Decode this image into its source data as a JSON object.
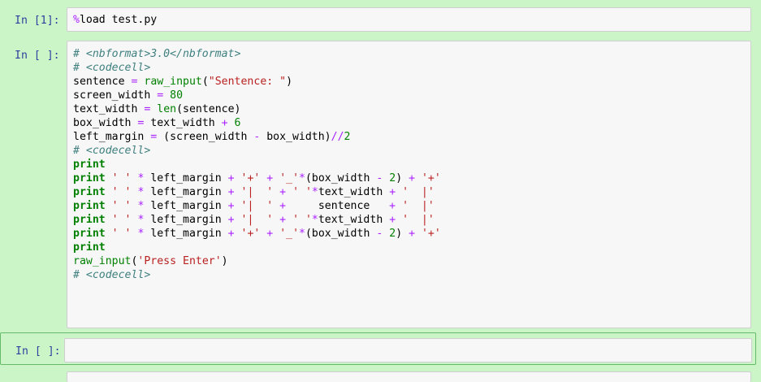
{
  "cells": [
    {
      "prompt": "In [1]:",
      "lines": [
        [
          {
            "t": "magic",
            "v": "%"
          },
          {
            "t": "plain",
            "v": "load test.py"
          }
        ]
      ]
    },
    {
      "prompt": "In [ ]:",
      "lines": [
        [
          {
            "t": "comment",
            "v": "# <nbformat>3.0</nbformat>"
          }
        ],
        [
          {
            "t": "comment",
            "v": "# <codecell>"
          }
        ],
        [
          {
            "t": "plain",
            "v": "sentence "
          },
          {
            "t": "op",
            "v": "="
          },
          {
            "t": "plain",
            "v": " "
          },
          {
            "t": "builtin",
            "v": "raw_input"
          },
          {
            "t": "plain",
            "v": "("
          },
          {
            "t": "string",
            "v": "\"Sentence: \""
          },
          {
            "t": "plain",
            "v": ")"
          }
        ],
        [
          {
            "t": "plain",
            "v": "screen_width "
          },
          {
            "t": "op",
            "v": "="
          },
          {
            "t": "plain",
            "v": " "
          },
          {
            "t": "number",
            "v": "80"
          }
        ],
        [
          {
            "t": "plain",
            "v": "text_width "
          },
          {
            "t": "op",
            "v": "="
          },
          {
            "t": "plain",
            "v": " "
          },
          {
            "t": "builtin",
            "v": "len"
          },
          {
            "t": "plain",
            "v": "(sentence)"
          }
        ],
        [
          {
            "t": "plain",
            "v": "box_width "
          },
          {
            "t": "op",
            "v": "="
          },
          {
            "t": "plain",
            "v": " text_width "
          },
          {
            "t": "op",
            "v": "+"
          },
          {
            "t": "plain",
            "v": " "
          },
          {
            "t": "number",
            "v": "6"
          }
        ],
        [
          {
            "t": "plain",
            "v": "left_margin "
          },
          {
            "t": "op",
            "v": "="
          },
          {
            "t": "plain",
            "v": " (screen_width "
          },
          {
            "t": "op",
            "v": "-"
          },
          {
            "t": "plain",
            "v": " box_width)"
          },
          {
            "t": "op",
            "v": "//"
          },
          {
            "t": "number",
            "v": "2"
          }
        ],
        [
          {
            "t": "comment",
            "v": "# <codecell>"
          }
        ],
        [
          {
            "t": "keyword",
            "v": "print"
          }
        ],
        [
          {
            "t": "keyword",
            "v": "print"
          },
          {
            "t": "plain",
            "v": " "
          },
          {
            "t": "string",
            "v": "' '"
          },
          {
            "t": "plain",
            "v": " "
          },
          {
            "t": "op",
            "v": "*"
          },
          {
            "t": "plain",
            "v": " left_margin "
          },
          {
            "t": "op",
            "v": "+"
          },
          {
            "t": "plain",
            "v": " "
          },
          {
            "t": "string",
            "v": "'+'"
          },
          {
            "t": "plain",
            "v": " "
          },
          {
            "t": "op",
            "v": "+"
          },
          {
            "t": "plain",
            "v": " "
          },
          {
            "t": "string",
            "v": "'_'"
          },
          {
            "t": "op",
            "v": "*"
          },
          {
            "t": "plain",
            "v": "(box_width "
          },
          {
            "t": "op",
            "v": "-"
          },
          {
            "t": "plain",
            "v": " "
          },
          {
            "t": "number",
            "v": "2"
          },
          {
            "t": "plain",
            "v": ") "
          },
          {
            "t": "op",
            "v": "+"
          },
          {
            "t": "plain",
            "v": " "
          },
          {
            "t": "string",
            "v": "'+'"
          }
        ],
        [
          {
            "t": "keyword",
            "v": "print"
          },
          {
            "t": "plain",
            "v": " "
          },
          {
            "t": "string",
            "v": "' '"
          },
          {
            "t": "plain",
            "v": " "
          },
          {
            "t": "op",
            "v": "*"
          },
          {
            "t": "plain",
            "v": " left_margin "
          },
          {
            "t": "op",
            "v": "+"
          },
          {
            "t": "plain",
            "v": " "
          },
          {
            "t": "string",
            "v": "'|  '"
          },
          {
            "t": "plain",
            "v": " "
          },
          {
            "t": "op",
            "v": "+"
          },
          {
            "t": "plain",
            "v": " "
          },
          {
            "t": "string",
            "v": "' '"
          },
          {
            "t": "op",
            "v": "*"
          },
          {
            "t": "plain",
            "v": "text_width "
          },
          {
            "t": "op",
            "v": "+"
          },
          {
            "t": "plain",
            "v": " "
          },
          {
            "t": "string",
            "v": "'  |'"
          }
        ],
        [
          {
            "t": "keyword",
            "v": "print"
          },
          {
            "t": "plain",
            "v": " "
          },
          {
            "t": "string",
            "v": "' '"
          },
          {
            "t": "plain",
            "v": " "
          },
          {
            "t": "op",
            "v": "*"
          },
          {
            "t": "plain",
            "v": " left_margin "
          },
          {
            "t": "op",
            "v": "+"
          },
          {
            "t": "plain",
            "v": " "
          },
          {
            "t": "string",
            "v": "'|  '"
          },
          {
            "t": "plain",
            "v": " "
          },
          {
            "t": "op",
            "v": "+"
          },
          {
            "t": "plain",
            "v": "     sentence   "
          },
          {
            "t": "op",
            "v": "+"
          },
          {
            "t": "plain",
            "v": " "
          },
          {
            "t": "string",
            "v": "'  |'"
          }
        ],
        [
          {
            "t": "keyword",
            "v": "print"
          },
          {
            "t": "plain",
            "v": " "
          },
          {
            "t": "string",
            "v": "' '"
          },
          {
            "t": "plain",
            "v": " "
          },
          {
            "t": "op",
            "v": "*"
          },
          {
            "t": "plain",
            "v": " left_margin "
          },
          {
            "t": "op",
            "v": "+"
          },
          {
            "t": "plain",
            "v": " "
          },
          {
            "t": "string",
            "v": "'|  '"
          },
          {
            "t": "plain",
            "v": " "
          },
          {
            "t": "op",
            "v": "+"
          },
          {
            "t": "plain",
            "v": " "
          },
          {
            "t": "string",
            "v": "' '"
          },
          {
            "t": "op",
            "v": "*"
          },
          {
            "t": "plain",
            "v": "text_width "
          },
          {
            "t": "op",
            "v": "+"
          },
          {
            "t": "plain",
            "v": " "
          },
          {
            "t": "string",
            "v": "'  |'"
          }
        ],
        [
          {
            "t": "keyword",
            "v": "print"
          },
          {
            "t": "plain",
            "v": " "
          },
          {
            "t": "string",
            "v": "' '"
          },
          {
            "t": "plain",
            "v": " "
          },
          {
            "t": "op",
            "v": "*"
          },
          {
            "t": "plain",
            "v": " left_margin "
          },
          {
            "t": "op",
            "v": "+"
          },
          {
            "t": "plain",
            "v": " "
          },
          {
            "t": "string",
            "v": "'+'"
          },
          {
            "t": "plain",
            "v": " "
          },
          {
            "t": "op",
            "v": "+"
          },
          {
            "t": "plain",
            "v": " "
          },
          {
            "t": "string",
            "v": "'_'"
          },
          {
            "t": "op",
            "v": "*"
          },
          {
            "t": "plain",
            "v": "(box_width "
          },
          {
            "t": "op",
            "v": "-"
          },
          {
            "t": "plain",
            "v": " "
          },
          {
            "t": "number",
            "v": "2"
          },
          {
            "t": "plain",
            "v": ") "
          },
          {
            "t": "op",
            "v": "+"
          },
          {
            "t": "plain",
            "v": " "
          },
          {
            "t": "string",
            "v": "'+'"
          }
        ],
        [
          {
            "t": "keyword",
            "v": "print"
          }
        ],
        [
          {
            "t": "builtin",
            "v": "raw_input"
          },
          {
            "t": "plain",
            "v": "("
          },
          {
            "t": "string",
            "v": "'Press Enter'"
          },
          {
            "t": "plain",
            "v": ")"
          }
        ],
        [
          {
            "t": "comment",
            "v": "# <codecell>"
          }
        ]
      ]
    },
    {
      "prompt": "In [ ]:",
      "lines": []
    }
  ],
  "colors": {
    "page_background": "#cbf5c7",
    "selected_cell_border": "#66bb6a",
    "prompt": "#303f9f",
    "comment": "#408080",
    "keyword": "#008000",
    "string": "#ba2121",
    "operator": "#aa22ff"
  }
}
